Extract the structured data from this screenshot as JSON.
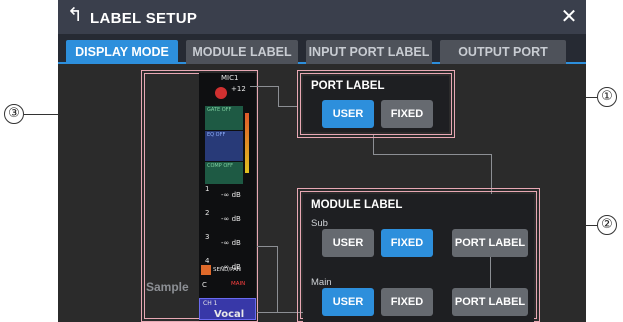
{
  "header": {
    "title": "LABEL SETUP",
    "back_icon": "back-arrow-icon",
    "close_icon": "close-icon"
  },
  "tabs": [
    {
      "label": "DISPLAY MODE",
      "active": true
    },
    {
      "label": "MODULE LABEL",
      "active": false
    },
    {
      "label": "INPUT PORT LABEL",
      "active": false
    },
    {
      "label": "OUTPUT PORT LABEL",
      "active": false
    }
  ],
  "port_label": {
    "title": "PORT LABEL",
    "user": "USER",
    "fixed": "FIXED",
    "selected": "USER"
  },
  "module_label": {
    "title": "MODULE LABEL",
    "sub": {
      "label": "Sub",
      "user": "USER",
      "fixed": "FIXED",
      "port": "PORT LABEL",
      "selected": "FIXED"
    },
    "main": {
      "label": "Main",
      "user": "USER",
      "fixed": "FIXED",
      "port": "PORT LABEL",
      "selected": "USER"
    }
  },
  "sample": {
    "label": "Sample",
    "input_name": "MIC1",
    "gain": "+12",
    "gate_label": "GATE OFF",
    "eq_label": "EQ OFF",
    "comp_label": "COMP OFF",
    "sends": [
      {
        "n": "1",
        "val": "-∞ dB"
      },
      {
        "n": "2",
        "val": "-∞ dB"
      },
      {
        "n": "3",
        "val": "-∞ dB"
      },
      {
        "n": "4",
        "val": "-∞ dB"
      }
    ],
    "send_pan": "SEND/PAN",
    "pan_c": "C",
    "main_badge": "MAIN",
    "channel": "CH 1",
    "name": "Vocal"
  },
  "callouts": {
    "one": "①",
    "two": "②",
    "three": "③"
  },
  "colors": {
    "accent": "#2d8fdc",
    "highlight": "#e8a8b4"
  }
}
